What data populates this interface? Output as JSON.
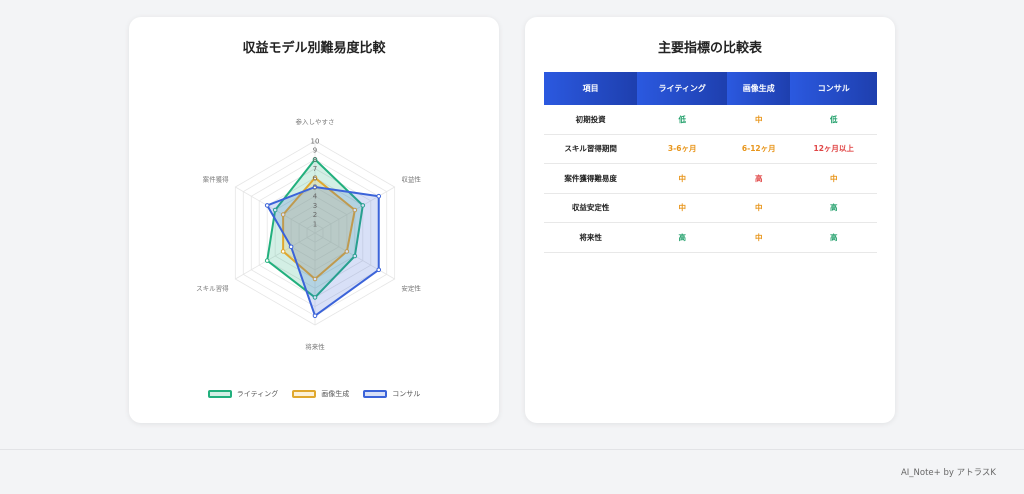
{
  "radar": {
    "title": "収益モデル別難易度比較",
    "legend": [
      {
        "name": "ライティング",
        "color": "#22b07d",
        "fill": "rgba(34,176,125,0.2)"
      },
      {
        "name": "画像生成",
        "color": "#e0a82e",
        "fill": "rgba(240,190,80,0.22)"
      },
      {
        "name": "コンサル",
        "color": "#3b63d9",
        "fill": "rgba(59,99,217,0.2)"
      }
    ]
  },
  "chart_data": {
    "type": "radar",
    "title": "収益モデル別難易度比較",
    "axes": [
      "参入しやすさ",
      "収益性",
      "安定性",
      "将来性",
      "スキル習得",
      "案件獲得"
    ],
    "rlim": [
      0,
      10
    ],
    "ticks": [
      "1",
      "2",
      "3",
      "4",
      "5",
      "6",
      "7",
      "8",
      "9",
      "10"
    ],
    "series": [
      {
        "name": "ライティング",
        "values": [
          8,
          6,
          5,
          7,
          6,
          5
        ]
      },
      {
        "name": "画像生成",
        "values": [
          6,
          5,
          4,
          5,
          4,
          4
        ]
      },
      {
        "name": "コンサル",
        "values": [
          5,
          8,
          8,
          9,
          3,
          6
        ]
      }
    ],
    "legend_position": "bottom"
  },
  "table": {
    "title": "主要指標の比較表",
    "headers": [
      "項目",
      "ライティング",
      "画像生成",
      "コンサル"
    ],
    "rows": [
      {
        "label": "初期投資",
        "cells": [
          {
            "text": "低",
            "color": "#22a06b"
          },
          {
            "text": "中",
            "color": "#e8951a"
          },
          {
            "text": "低",
            "color": "#22a06b"
          }
        ]
      },
      {
        "label": "スキル習得期間",
        "cells": [
          {
            "text": "3-6ヶ月",
            "color": "#e8951a"
          },
          {
            "text": "6-12ヶ月",
            "color": "#e8951a"
          },
          {
            "text": "12ヶ月以上",
            "color": "#e04545"
          }
        ]
      },
      {
        "label": "案件獲得難易度",
        "cells": [
          {
            "text": "中",
            "color": "#e8951a"
          },
          {
            "text": "高",
            "color": "#e04545"
          },
          {
            "text": "中",
            "color": "#e8951a"
          }
        ]
      },
      {
        "label": "収益安定性",
        "cells": [
          {
            "text": "中",
            "color": "#e8951a"
          },
          {
            "text": "中",
            "color": "#e8951a"
          },
          {
            "text": "高",
            "color": "#22a06b"
          }
        ]
      },
      {
        "label": "将来性",
        "cells": [
          {
            "text": "高",
            "color": "#22a06b"
          },
          {
            "text": "中",
            "color": "#e8951a"
          },
          {
            "text": "高",
            "color": "#22a06b"
          }
        ]
      }
    ]
  },
  "footer": {
    "text": "AI_Note+ by アトラスK"
  }
}
